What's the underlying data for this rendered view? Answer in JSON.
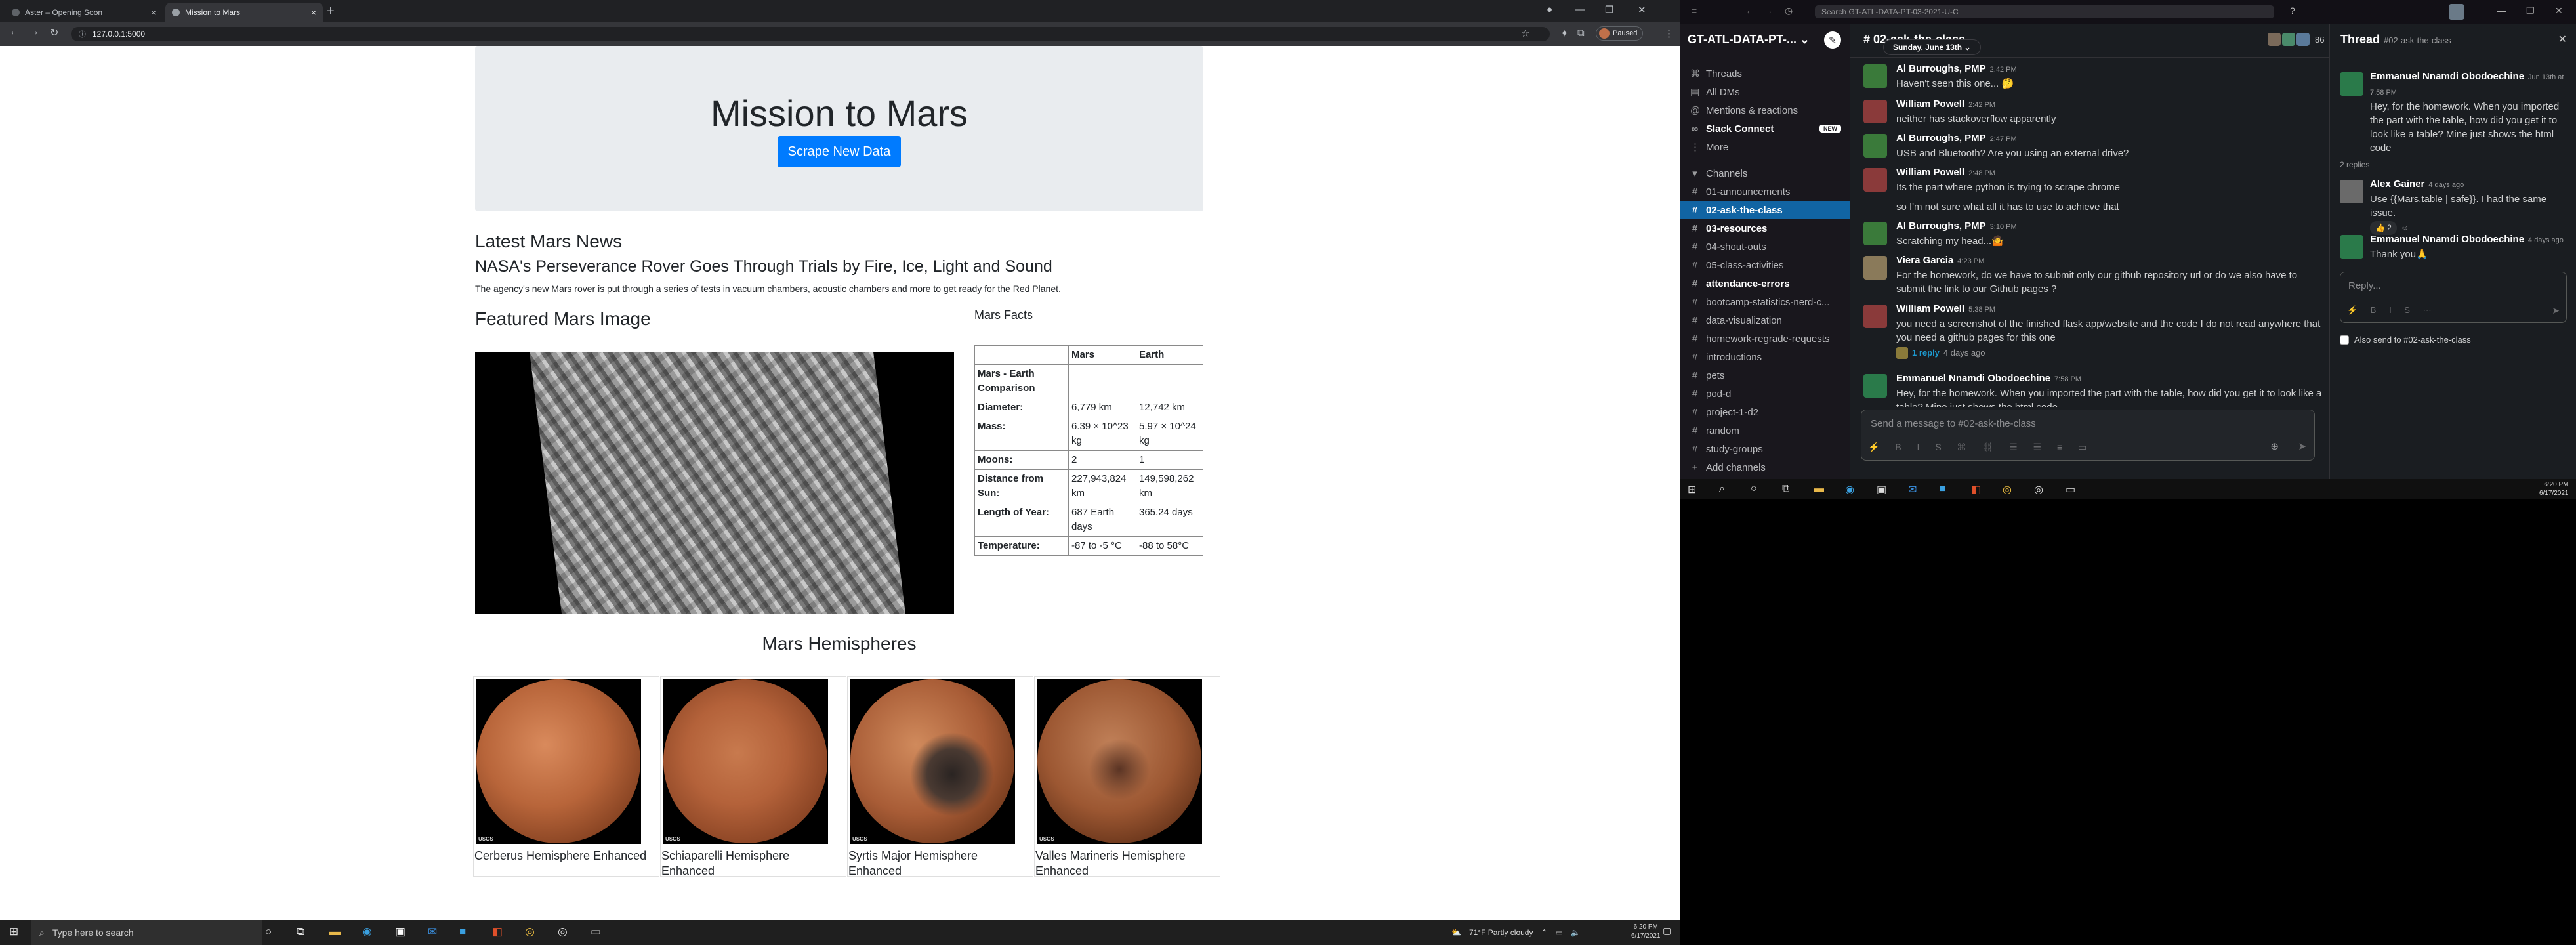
{
  "browser": {
    "tabs": [
      {
        "label": "Aster – Opening Soon"
      },
      {
        "label": "Mission to Mars"
      }
    ],
    "url": "127.0.0.1:5000",
    "profile_status": "Paused"
  },
  "mars": {
    "title": "Mission to Mars",
    "scrape_button": "Scrape New Data",
    "news_heading": "Latest Mars News",
    "news_title": "NASA's Perseverance Rover Goes Through Trials by Fire, Ice, Light and Sound",
    "news_teaser": "The agency's new Mars rover is put through a series of tests in vacuum chambers, acoustic chambers and more to get ready for the Red Planet.",
    "featured_heading": "Featured Mars Image",
    "facts_heading": "Mars Facts",
    "facts_table": {
      "headers": [
        "",
        "Mars",
        "Earth"
      ],
      "rows": [
        [
          "Mars - Earth Comparison",
          "",
          ""
        ],
        [
          "Diameter:",
          "6,779 km",
          "12,742 km"
        ],
        [
          "Mass:",
          "6.39 × 10^23 kg",
          "5.97 × 10^24 kg"
        ],
        [
          "Moons:",
          "2",
          "1"
        ],
        [
          "Distance from Sun:",
          "227,943,824 km",
          "149,598,262 km"
        ],
        [
          "Length of Year:",
          "687 Earth days",
          "365.24 days"
        ],
        [
          "Temperature:",
          "-87 to -5 °C",
          "-88 to 58°C"
        ]
      ]
    },
    "hemispheres_heading": "Mars Hemispheres",
    "hemispheres": [
      {
        "title": "Cerberus Hemisphere Enhanced",
        "color": "#b8653a"
      },
      {
        "title": "Schiaparelli Hemisphere Enhanced",
        "color": "#b4623a"
      },
      {
        "title": "Syrtis Major Hemisphere Enhanced",
        "color": "#a85c36"
      },
      {
        "title": "Valles Marineris Hemisphere Enhanced",
        "color": "#9c5732"
      }
    ],
    "usgs_label": "USGS"
  },
  "taskbar_left": {
    "search_placeholder": "Type here to search",
    "weather": "71°F  Partly cloudy",
    "time": "6:20 PM",
    "date": "6/17/2021"
  },
  "slack": {
    "search_placeholder": "Search GT-ATL-DATA-PT-03-2021-U-C",
    "workspace": "GT-ATL-DATA-PT-...",
    "nav": [
      {
        "label": "Threads"
      },
      {
        "label": "All DMs"
      },
      {
        "label": "Mentions & reactions"
      },
      {
        "label": "Slack Connect",
        "badge": "NEW"
      },
      {
        "label": "More"
      }
    ],
    "channels_label": "Channels",
    "channels": [
      {
        "name": "01-announcements",
        "bold": false
      },
      {
        "name": "02-ask-the-class",
        "bold": true,
        "selected": true
      },
      {
        "name": "03-resources",
        "bold": true
      },
      {
        "name": "04-shout-outs",
        "bold": false
      },
      {
        "name": "05-class-activities",
        "bold": false
      },
      {
        "name": "attendance-errors",
        "bold": true
      },
      {
        "name": "bootcamp-statistics-nerd-c...",
        "bold": false
      },
      {
        "name": "data-visualization",
        "bold": false
      },
      {
        "name": "homework-regrade-requests",
        "bold": false
      },
      {
        "name": "introductions",
        "bold": false
      },
      {
        "name": "pets",
        "bold": false
      },
      {
        "name": "pod-d",
        "bold": false
      },
      {
        "name": "project-1-d2",
        "bold": false
      },
      {
        "name": "random",
        "bold": false
      },
      {
        "name": "study-groups",
        "bold": false
      }
    ],
    "add_channels": "Add channels",
    "channel_title": "# 02-ask-the-class",
    "member_count": "86",
    "date_divider": "Sunday, June 13th",
    "messages": [
      {
        "name": "Al Burroughs, PMP",
        "time": "2:42 PM",
        "lines": [
          "Haven't seen this one... 🤔"
        ]
      },
      {
        "name": "William Powell",
        "time": "2:42 PM",
        "lines": [
          "neither has stackoverflow apparently"
        ]
      },
      {
        "name": "Al Burroughs, PMP",
        "time": "2:47 PM",
        "lines": [
          "USB and Bluetooth? Are you using an external drive?"
        ]
      },
      {
        "name": "William Powell",
        "time": "2:48 PM",
        "lines": [
          "Its the part where python is trying to scrape chrome",
          "so I'm not sure what all it has to use to achieve that"
        ]
      },
      {
        "name": "Al Burroughs, PMP",
        "time": "3:10 PM",
        "lines": [
          "Scratching my head...🤷"
        ]
      },
      {
        "name": "Viera Garcia",
        "time": "4:23 PM",
        "lines": [
          "For the homework, do we have to submit only our github repository url or do we also have to submit the link to our Github pages ?"
        ]
      },
      {
        "name": "William Powell",
        "time": "5:38 PM",
        "lines": [
          "you need a screenshot of the finished flask app/website and the code I do not read anywhere that you need a github pages for this one"
        ],
        "reply": "1 reply",
        "reply_ago": "4 days ago"
      },
      {
        "name": "Emmanuel Nnamdi Obodoechine",
        "time": "7:58 PM",
        "lines": [
          "Hey, for the homework. When you imported the part with the table, how did you get it to look like a table? Mine just shows the html code"
        ]
      }
    ],
    "message_placeholder": "Send a message to #02-ask-the-class",
    "thread": {
      "title": "Thread",
      "channel": "#02-ask-the-class",
      "parent": {
        "name": "Emmanuel Nnamdi Obodoechine",
        "time": "Jun 13th at 7:58 PM",
        "text": "Hey, for the homework. When you imported the part with the table, how did you get it to look like a table? Mine just shows the html code"
      },
      "replies_count": "2 replies",
      "replies": [
        {
          "name": "Alex Gainer",
          "time": "4 days ago",
          "text": "Use {{Mars.table | safe}}. I had the same issue.",
          "reaction": "👍 2"
        },
        {
          "name": "Emmanuel Nnamdi Obodoechine",
          "time": "4 days ago",
          "text": "Thank you🙏"
        }
      ],
      "reply_placeholder": "Reply...",
      "also_send": "Also send to #02-ask-the-class"
    }
  },
  "taskbar_right": {
    "time": "6:20 PM",
    "date": "6/17/2021"
  }
}
